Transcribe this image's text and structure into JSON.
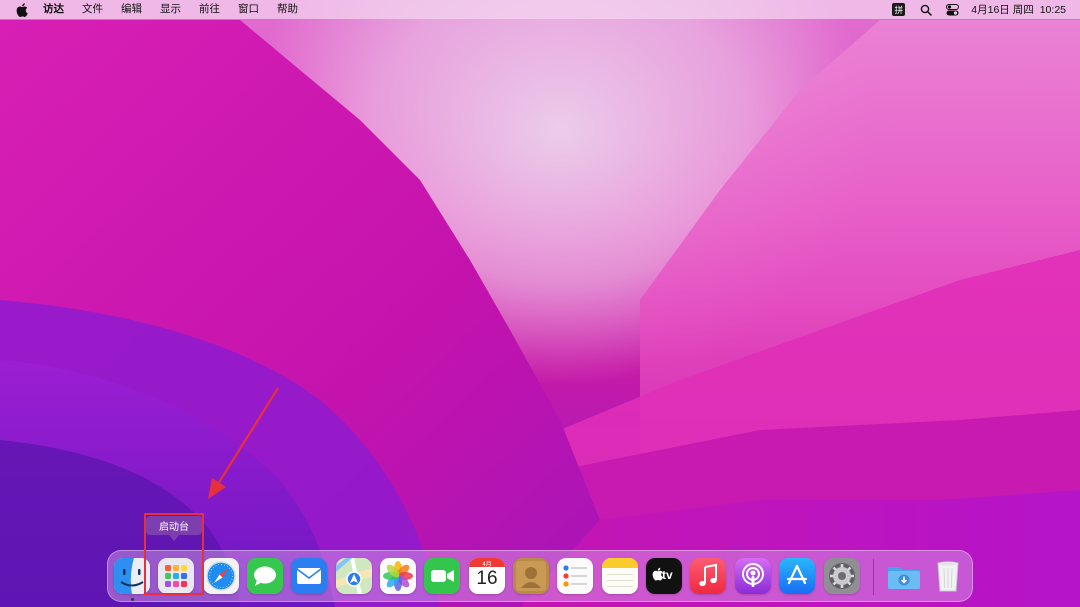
{
  "menubar": {
    "app_name": "访达",
    "items": [
      "文件",
      "编辑",
      "显示",
      "前往",
      "窗口",
      "帮助"
    ],
    "ime_label": "拼",
    "date": "4月16日 周四",
    "time": "10:25"
  },
  "tooltip": {
    "label": "启动台"
  },
  "calendar": {
    "month": "4月",
    "day": "16"
  },
  "dock": {
    "items": [
      {
        "name": "finder",
        "icon": "finder-icon",
        "running": true
      },
      {
        "name": "launchpad",
        "icon": "launchpad-icon",
        "running": false
      },
      {
        "name": "safari",
        "icon": "safari-icon",
        "running": false
      },
      {
        "name": "messages",
        "icon": "messages-icon",
        "running": false
      },
      {
        "name": "mail",
        "icon": "mail-icon",
        "running": false
      },
      {
        "name": "maps",
        "icon": "maps-icon",
        "running": false
      },
      {
        "name": "photos",
        "icon": "photos-icon",
        "running": false
      },
      {
        "name": "facetime",
        "icon": "facetime-icon",
        "running": false
      },
      {
        "name": "calendar",
        "icon": "calendar-icon",
        "running": false
      },
      {
        "name": "contacts",
        "icon": "contacts-icon",
        "running": false
      },
      {
        "name": "reminders",
        "icon": "reminders-icon",
        "running": false
      },
      {
        "name": "notes",
        "icon": "notes-icon",
        "running": false
      },
      {
        "name": "apple-tv",
        "icon": "apple-tv-icon",
        "running": false
      },
      {
        "name": "music",
        "icon": "music-icon",
        "running": false
      },
      {
        "name": "podcasts",
        "icon": "podcasts-icon",
        "running": false
      },
      {
        "name": "app-store",
        "icon": "app-store-icon",
        "running": false
      },
      {
        "name": "system-preferences",
        "icon": "gear-icon",
        "running": false
      },
      {
        "name": "downloads",
        "icon": "downloads-folder-icon",
        "running": false
      },
      {
        "name": "trash",
        "icon": "trash-icon",
        "running": false
      }
    ],
    "tv_label": "tv"
  },
  "colors": {
    "annotation": "#e8303c",
    "tooltip_bg": "#7d3fb0"
  }
}
